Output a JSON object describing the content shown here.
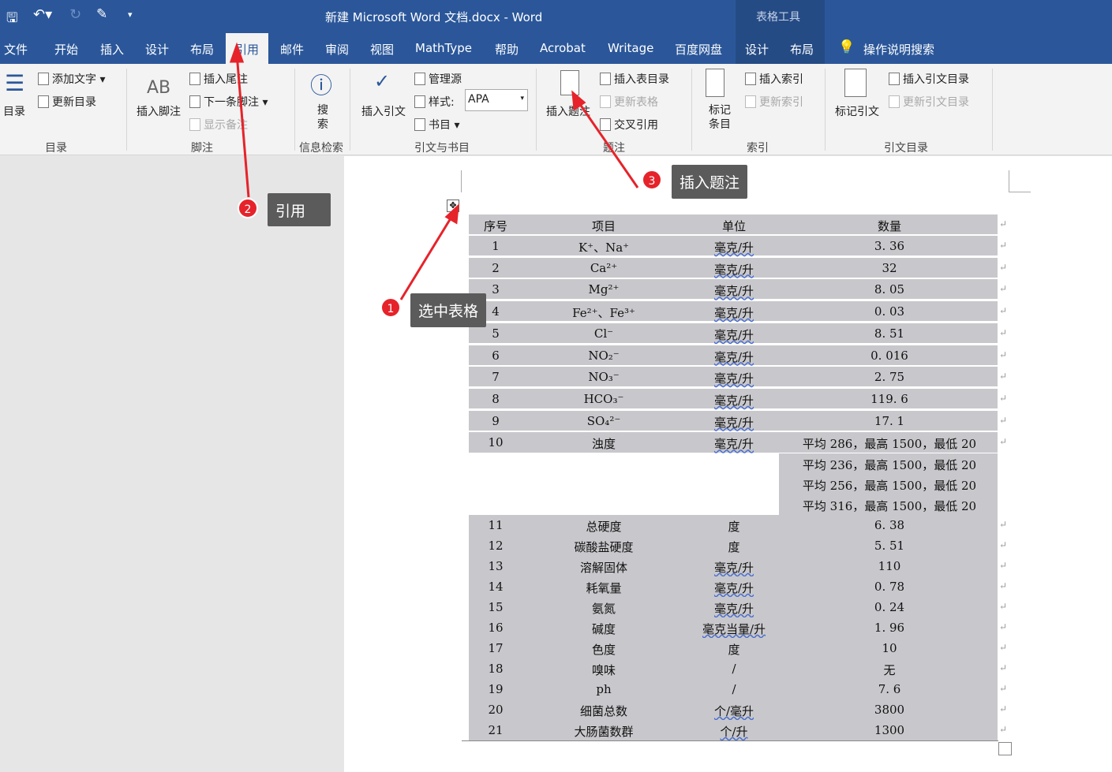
{
  "title": "新建 Microsoft Word 文档.docx  -  Word",
  "context_tab": "表格工具",
  "tabs": [
    "文件",
    "开始",
    "插入",
    "设计",
    "布局",
    "引用",
    "邮件",
    "审阅",
    "视图",
    "MathType",
    "帮助",
    "Acrobat",
    "Writage",
    "百度网盘",
    "设计",
    "布局"
  ],
  "tell_me": "操作说明搜索",
  "ribbon": {
    "toc": {
      "big": "目录",
      "add_text": "添加文字",
      "update": "更新目录",
      "group": "目录"
    },
    "footnote": {
      "insert_footnote": "插入脚注",
      "insert_endnote": "插入尾注",
      "next_footnote": "下一条脚注",
      "show_notes": "显示备注",
      "group": "脚注",
      "ab": "AB"
    },
    "research": {
      "search": "搜\n索",
      "group": "信息检索"
    },
    "citations": {
      "insert_citation": "插入引文",
      "manage": "管理源",
      "style_label": "样式:",
      "style_value": "APA",
      "bibliography": "书目",
      "group": "引文与书目"
    },
    "captions": {
      "insert_caption": "插入题注",
      "insert_tof": "插入表目录",
      "update_table": "更新表格",
      "cross_ref": "交叉引用",
      "group": "题注"
    },
    "index": {
      "mark_entry": "标记\n条目",
      "insert_index": "插入索引",
      "update_index": "更新索引",
      "group": "索引"
    },
    "toa": {
      "mark_citation": "标记引文",
      "insert_toa": "插入引文目录",
      "update_toa": "更新引文目录",
      "group": "引文目录"
    }
  },
  "table": {
    "headers": [
      "序号",
      "项目",
      "单位",
      "数量"
    ],
    "rows": [
      [
        "1",
        "K⁺、Na⁺",
        "毫克/升",
        "3. 36"
      ],
      [
        "2",
        "Ca²⁺",
        "毫克/升",
        "32"
      ],
      [
        "3",
        "Mg²⁺",
        "毫克/升",
        "8. 05"
      ],
      [
        "4",
        "Fe²⁺、Fe³⁺",
        "毫克/升",
        "0. 03"
      ],
      [
        "5",
        "Cl⁻",
        "毫克/升",
        "8. 51"
      ],
      [
        "6",
        "NO₂⁻",
        "毫克/升",
        "0. 016"
      ],
      [
        "7",
        "NO₃⁻",
        "毫克/升",
        "2. 75"
      ],
      [
        "8",
        "HCO₃⁻",
        "毫克/升",
        "119. 6"
      ],
      [
        "9",
        "SO₄²⁻",
        "毫克/升",
        "17. 1"
      ],
      [
        "10",
        "浊度",
        "毫克/升",
        "平均 286，最高 1500，最低 20"
      ]
    ],
    "extra_lines": [
      "平均 236，最高 1500，最低 20",
      "平均 256，最高 1500，最低 20",
      "平均 316，最高 1500，最低 20"
    ],
    "rows2": [
      [
        "11",
        "总硬度",
        "度",
        "6. 38"
      ],
      [
        "12",
        "碳酸盐硬度",
        "度",
        "5. 51"
      ],
      [
        "13",
        "溶解固体",
        "毫克/升",
        "110"
      ],
      [
        "14",
        "耗氧量",
        "毫克/升",
        "0. 78"
      ],
      [
        "15",
        "氨氮",
        "毫克/升",
        "0. 24"
      ],
      [
        "16",
        "碱度",
        "毫克当量/升",
        "1. 96"
      ],
      [
        "17",
        "色度",
        "度",
        "10"
      ],
      [
        "18",
        "嗅味",
        "/",
        "无"
      ],
      [
        "19",
        "ph",
        "/",
        "7. 6"
      ],
      [
        "20",
        "细菌总数",
        "个/毫升",
        "3800"
      ],
      [
        "21",
        "大肠菌数群",
        "个/升",
        "1300"
      ]
    ]
  },
  "annotations": [
    {
      "num": "1",
      "text": "选中表格"
    },
    {
      "num": "2",
      "text": "引用"
    },
    {
      "num": "3",
      "text": "插入题注"
    }
  ],
  "colors": {
    "brand": "#2b579a",
    "arrow": "#e6232a"
  }
}
